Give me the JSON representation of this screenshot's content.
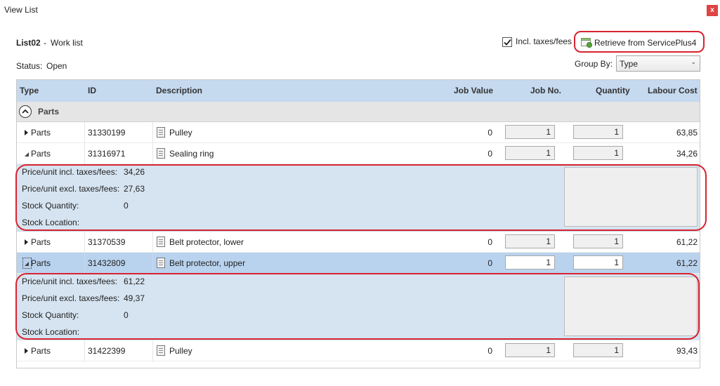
{
  "window": {
    "title": "View List",
    "close_label": "x"
  },
  "list": {
    "name": "List02",
    "separator": "-",
    "description": "Work list"
  },
  "status": {
    "label": "Status:",
    "value": "Open"
  },
  "incl_taxes": {
    "label": "Incl. taxes/fees",
    "checked": true
  },
  "retrieve": {
    "label": "Retrieve from ServicePlus4"
  },
  "group_by": {
    "label": "Group By:",
    "value": "Type"
  },
  "columns": {
    "type": "Type",
    "id": "ID",
    "description": "Description",
    "job_value": "Job Value",
    "job_no": "Job No.",
    "quantity": "Quantity",
    "labour_cost": "Labour Cost"
  },
  "group": {
    "label": "Parts"
  },
  "rows": [
    {
      "type": "Parts",
      "id": "31330199",
      "description": "Pulley",
      "job_value": "0",
      "job_no": "1",
      "quantity": "1",
      "labour_cost": "63,85"
    },
    {
      "type": "Parts",
      "id": "31316971",
      "description": "Sealing ring",
      "job_value": "0",
      "job_no": "1",
      "quantity": "1",
      "labour_cost": "34,26"
    },
    {
      "type": "Parts",
      "id": "31370539",
      "description": "Belt protector, lower",
      "job_value": "0",
      "job_no": "1",
      "quantity": "1",
      "labour_cost": "61,22"
    },
    {
      "type": "Parts",
      "id": "31432809",
      "description": "Belt protector, upper",
      "job_value": "0",
      "job_no": "1",
      "quantity": "1",
      "labour_cost": "61,22"
    },
    {
      "type": "Parts",
      "id": "31422399",
      "description": "Pulley",
      "job_value": "0",
      "job_no": "1",
      "quantity": "1",
      "labour_cost": "93,43"
    }
  ],
  "detail_labels": {
    "price_incl": "Price/unit incl. taxes/fees:",
    "price_excl": "Price/unit excl. taxes/fees:",
    "stock_qty": "Stock Quantity:",
    "stock_loc": "Stock Location:"
  },
  "details": [
    {
      "price_incl": "34,26",
      "price_excl": "27,63",
      "stock_qty": "0",
      "stock_loc": ""
    },
    {
      "price_incl": "61,22",
      "price_excl": "49,37",
      "stock_qty": "0",
      "stock_loc": ""
    }
  ],
  "colors": {
    "header_bg": "#c5d9ef",
    "selected_row": "#b9d2ee",
    "detail_bg": "#d6e4f1",
    "highlight_oval": "#d9232f",
    "close_button": "#e04343"
  }
}
